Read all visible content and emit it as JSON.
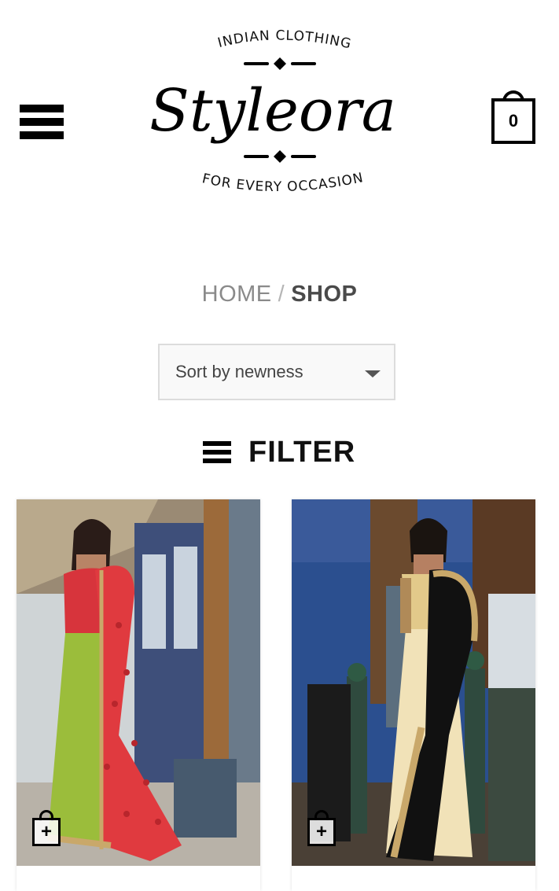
{
  "header": {
    "menu_icon": "hamburger-menu-icon",
    "logo": {
      "top_text": "INDIAN CLOTHING",
      "script_text": "Styleora",
      "bottom_text": "FOR EVERY OCCASION"
    },
    "cart": {
      "icon": "shopping-bag-icon",
      "count": "0"
    }
  },
  "breadcrumb": {
    "home": "HOME",
    "separator": "/",
    "current": "SHOP"
  },
  "sort": {
    "selected": "Sort by newness"
  },
  "filter": {
    "icon": "filter-list-icon",
    "label": "FILTER"
  },
  "products": [
    {
      "image_desc_colors": [
        "#e03a3f",
        "#9bbd3b",
        "#c9a86a"
      ],
      "quick_add_icon": "add-to-bag-icon",
      "quick_add_symbol": "+"
    },
    {
      "image_desc_colors": [
        "#111111",
        "#f1e2b8",
        "#1f3e73"
      ],
      "quick_add_icon": "add-to-bag-icon",
      "quick_add_symbol": "+"
    }
  ],
  "colors": {
    "text_primary": "#111111",
    "breadcrumb_home": "#8a8a8a",
    "breadcrumb_current": "#4a4a4a",
    "sort_border": "#dcdcdc"
  }
}
